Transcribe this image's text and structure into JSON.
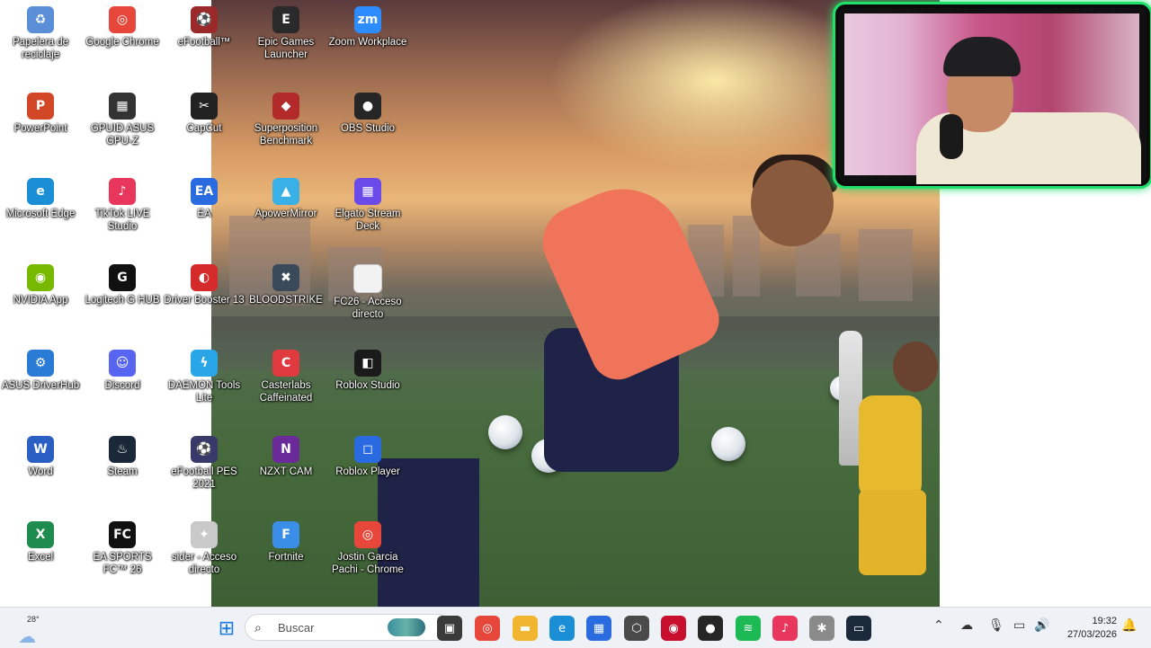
{
  "desktop": {
    "icons": [
      {
        "label": "Papelera de reciclaje",
        "icon": "recycle-bin-icon",
        "color": "#5a8fd8",
        "glyph": "♻"
      },
      {
        "label": "PowerPoint",
        "icon": "powerpoint-icon",
        "color": "#d24726",
        "glyph": "P"
      },
      {
        "label": "Microsoft Edge",
        "icon": "edge-icon",
        "color": "#1a8fd6",
        "glyph": "e"
      },
      {
        "label": "NVIDIA App",
        "icon": "nvidia-icon",
        "color": "#76b900",
        "glyph": "◉"
      },
      {
        "label": "ASUS DriverHub",
        "icon": "gear-icon",
        "color": "#2a7bd6",
        "glyph": "⚙"
      },
      {
        "label": "Word",
        "icon": "word-icon",
        "color": "#2b5fc4",
        "glyph": "W"
      },
      {
        "label": "Excel",
        "icon": "excel-icon",
        "color": "#1d8c4e",
        "glyph": "X"
      },
      {
        "label": "Google Chrome",
        "icon": "chrome-icon",
        "color": "#e6473a",
        "glyph": "◎"
      },
      {
        "label": "GPUID ASUS GPU-Z",
        "icon": "gpuz-icon",
        "color": "#333333",
        "glyph": "▦"
      },
      {
        "label": "TikTok LIVE Studio",
        "icon": "tiktok-icon",
        "color": "#e8365d",
        "glyph": "♪"
      },
      {
        "label": "Logitech G HUB",
        "icon": "logitech-icon",
        "color": "#111111",
        "glyph": "G"
      },
      {
        "label": "Discord",
        "icon": "discord-icon",
        "color": "#5865f2",
        "glyph": "☺"
      },
      {
        "label": "Steam",
        "icon": "steam-icon",
        "color": "#1b2838",
        "glyph": "♨"
      },
      {
        "label": "EA SPORTS FC™ 26",
        "icon": "easports-icon",
        "color": "#111111",
        "glyph": "FC"
      },
      {
        "label": "eFootball™",
        "icon": "efootball-icon",
        "color": "#9a2a2a",
        "glyph": "⚽"
      },
      {
        "label": "CapCut",
        "icon": "capcut-icon",
        "color": "#222222",
        "glyph": "✂"
      },
      {
        "label": "EA",
        "icon": "ea-icon",
        "color": "#2a6be0",
        "glyph": "EA"
      },
      {
        "label": "Driver Booster 13",
        "icon": "driverbooster-icon",
        "color": "#d42a2a",
        "glyph": "◐"
      },
      {
        "label": "DAEMON Tools Lite",
        "icon": "daemon-tools-icon",
        "color": "#28a6e8",
        "glyph": "ϟ"
      },
      {
        "label": "eFootball PES 2021",
        "icon": "pes-icon",
        "color": "#3a3a6a",
        "glyph": "⚽"
      },
      {
        "label": "sider - Acceso directo",
        "icon": "sider-icon",
        "color": "#c9c9c9",
        "glyph": "✦"
      },
      {
        "label": "Epic Games Launcher",
        "icon": "epic-games-icon",
        "color": "#2a2a2a",
        "glyph": "E"
      },
      {
        "label": "Superposition Benchmark",
        "icon": "benchmark-icon",
        "color": "#b32a2a",
        "glyph": "◆"
      },
      {
        "label": "ApowerMirror",
        "icon": "apowermirror-icon",
        "color": "#3ab0e8",
        "glyph": "▲"
      },
      {
        "label": "BLOODSTRIKE",
        "icon": "bloodstrike-icon",
        "color": "#3a4a5a",
        "glyph": "✖"
      },
      {
        "label": "Casterlabs Caffeinated",
        "icon": "casterlabs-icon",
        "color": "#e0393e",
        "glyph": "C"
      },
      {
        "label": "NZXT CAM",
        "icon": "nzxt-icon",
        "color": "#6a2a9a",
        "glyph": "N"
      },
      {
        "label": "Fortnite",
        "icon": "fortnite-icon",
        "color": "#3a8ee8",
        "glyph": "F"
      },
      {
        "label": "Zoom Workplace",
        "icon": "zoom-icon",
        "color": "#2d8cff",
        "glyph": "zm"
      },
      {
        "label": "OBS Studio",
        "icon": "obs-icon",
        "color": "#262626",
        "glyph": "●"
      },
      {
        "label": "Elgato Stream Deck",
        "icon": "streamdeck-icon",
        "color": "#6a4ae8",
        "glyph": "▦"
      },
      {
        "label": "FC26 - Acceso directo",
        "icon": "file-icon",
        "color": "#f2f2f2",
        "glyph": ""
      },
      {
        "label": "Roblox Studio",
        "icon": "roblox-studio-icon",
        "color": "#1a1a1a",
        "glyph": "◧"
      },
      {
        "label": "Roblox Player",
        "icon": "roblox-icon",
        "color": "#2a6ae0",
        "glyph": "◻"
      },
      {
        "label": "Jostin Garcia Pachi - Chrome",
        "icon": "chrome-icon",
        "color": "#e6473a",
        "glyph": "◎"
      }
    ]
  },
  "taskbar": {
    "weather": {
      "temp": "28°",
      "icon": "cloud-icon"
    },
    "search_placeholder": "Buscar",
    "apps": [
      {
        "name": "start-button",
        "icon": "windows-icon",
        "color": "#1e7ae0",
        "glyph": "⊞"
      },
      {
        "name": "task-view",
        "icon": "task-view-icon",
        "color": "#3a3a3a",
        "glyph": "▣"
      },
      {
        "name": "chrome",
        "icon": "chrome-icon",
        "color": "#e6473a",
        "glyph": "◎"
      },
      {
        "name": "file-explorer",
        "icon": "folder-icon",
        "color": "#f2b530",
        "glyph": "▬"
      },
      {
        "name": "edge",
        "icon": "edge-icon",
        "color": "#1a8fd6",
        "glyph": "e"
      },
      {
        "name": "store",
        "icon": "store-icon",
        "color": "#2a6be0",
        "glyph": "▦"
      },
      {
        "name": "app-hex",
        "icon": "hex-icon",
        "color": "#4a4a4a",
        "glyph": "⬡"
      },
      {
        "name": "app-red",
        "icon": "red-app-icon",
        "color": "#c8102e",
        "glyph": "◉"
      },
      {
        "name": "obs",
        "icon": "obs-icon",
        "color": "#262626",
        "glyph": "●"
      },
      {
        "name": "spotify",
        "icon": "spotify-icon",
        "color": "#1db954",
        "glyph": "≋"
      },
      {
        "name": "tiktok",
        "icon": "tiktok-icon",
        "color": "#e8365d",
        "glyph": "♪"
      },
      {
        "name": "tools",
        "icon": "tools-icon",
        "color": "#8a8a8a",
        "glyph": "✱"
      },
      {
        "name": "capture",
        "icon": "capture-icon",
        "color": "#1a2a3a",
        "glyph": "▭"
      }
    ],
    "tray": {
      "chevron": "chevron-up-icon",
      "onedrive": "cloud-icon",
      "mic": "microphone-icon",
      "display": "display-icon",
      "volume": "speaker-icon",
      "notifications": "notification-icon"
    },
    "clock": {
      "time": "19:32",
      "date": "27/03/2026"
    }
  }
}
